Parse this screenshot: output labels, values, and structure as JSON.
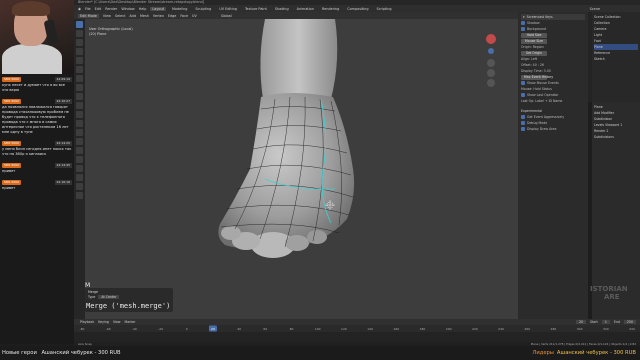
{
  "window": {
    "title": "Blender* [C:\\Users\\Ded\\Desktop\\Blender Stream\\stream-retopology.blend]"
  },
  "menubar": {
    "items": [
      "File",
      "Edit",
      "Render",
      "Window",
      "Help"
    ],
    "workspaces": [
      "Layout",
      "Modeling",
      "Sculpting",
      "UV Editing",
      "Texture Paint",
      "Shading",
      "Animation",
      "Rendering",
      "Compositing",
      "Scripting"
    ],
    "active_workspace": "Layout",
    "right_label": "Scene"
  },
  "viewport_header": {
    "mode": "Edit Mode",
    "menus": [
      "View",
      "Select",
      "Add",
      "Mesh",
      "Vertex",
      "Edge",
      "Face",
      "UV"
    ],
    "transform": "Global"
  },
  "viewport": {
    "info_line1": "User Orthographic (Local)",
    "info_line2": "(20) Plane"
  },
  "npanel": {
    "header": "Screencast Keys",
    "rows": [
      {
        "type": "check",
        "label": "Shadow"
      },
      {
        "type": "check",
        "label": "Background"
      },
      {
        "type": "button",
        "label": "Hold Size"
      },
      {
        "type": "button",
        "label": "Mouse Size"
      },
      {
        "type": "text",
        "label": "Origin: Region"
      },
      {
        "type": "button",
        "label": "Set Origin"
      },
      {
        "type": "text",
        "label": "Align: Left"
      },
      {
        "type": "text",
        "label": "Offset: 40 : 26"
      },
      {
        "type": "text",
        "label": "Display Time: 3.00"
      },
      {
        "type": "button",
        "label": "Max Event History"
      },
      {
        "type": "check",
        "label": "Show Mouse Events"
      },
      {
        "type": "text",
        "label": "Mouse: Hold Status"
      },
      {
        "type": "check",
        "label": "Show Last Operator"
      },
      {
        "type": "text",
        "label": "Last Op: Label + ID Name"
      }
    ],
    "experimental": "Experimental",
    "exp_items": [
      "Get Event Aggressively",
      "Debug Mode",
      "Display Draw Area"
    ]
  },
  "outliner": {
    "rows": [
      {
        "label": "Scene Collection",
        "sel": false
      },
      {
        "label": "Collection",
        "sel": false
      },
      {
        "label": "Camera",
        "sel": false
      },
      {
        "label": "Light",
        "sel": false
      },
      {
        "label": "Foot",
        "sel": false
      },
      {
        "label": "Plane",
        "sel": true
      },
      {
        "label": "Reference",
        "sel": false
      },
      {
        "label": "Sketch",
        "sel": false
      }
    ]
  },
  "properties": {
    "rows": [
      "Plane",
      "Add Modifier",
      "Subdivision",
      "Levels Viewport 1",
      "Render 2",
      "Subdivisions"
    ]
  },
  "last_operator": {
    "title": "Merge",
    "field_label": "Type",
    "field_value": "At Center"
  },
  "key_display": "M",
  "operator_tip": "Merge ('mesh.merge')",
  "timeline": {
    "menus": [
      "Playback",
      "Keying",
      "View",
      "Marker"
    ],
    "current_frame": "20",
    "start_label": "Start",
    "start": "1",
    "end_label": "End",
    "end": "250",
    "ticks": [
      "-80",
      "-60",
      "-40",
      "-20",
      "0",
      "20",
      "40",
      "60",
      "80",
      "100",
      "120",
      "140",
      "160",
      "180",
      "200",
      "220",
      "240",
      "260",
      "280",
      "300",
      "320",
      "340"
    ]
  },
  "status": {
    "left": "Axis Snap",
    "right": "Plane | Verts 211/1,278 | Edges 0/2,412 | Faces 0/1,124 | Objects 1/4 | 2.82"
  },
  "chat": [
    {
      "badge": "SMS 5000",
      "time": "22:09:19",
      "text": "кунк несет и думает что я во все это верю"
    },
    {
      "badge": "SMS 5000",
      "time": "22:10:27",
      "text": "да появлялся повлажился говорят провода стаханкоовую проблем не будет провод что к телефонного провода что с много в самих интересное что ростелеком 16 лет мне одну в туне"
    },
    {
      "badge": "SMS 5000",
      "time": "22:14:20",
      "text": "у меня блин сегодня инет поиск так что на 360р я кинзаиск"
    },
    {
      "badge": "SMS 5000",
      "time": "22:14:45",
      "text": "привет"
    },
    {
      "badge": "SMS 5000",
      "time": "22:16:16",
      "text": "привет"
    }
  ],
  "ticker": {
    "left": "Новые герои",
    "left_value": "Ашанский чебурек - 300 RUB",
    "leaders": "Лидеры",
    "leaders_value": "Ашанский чебурек - 300 RUB"
  },
  "watermark": [
    "ISTORIAN",
    "ARE"
  ],
  "colors": {
    "accent": "#4a6ea8",
    "chat_badge": "#d96a1c",
    "ticker_leaders": "#e8913c",
    "ticker_value": "#f0c14c",
    "mesh_edge": "#1a1a1a",
    "seam": "#3fd0d0"
  }
}
